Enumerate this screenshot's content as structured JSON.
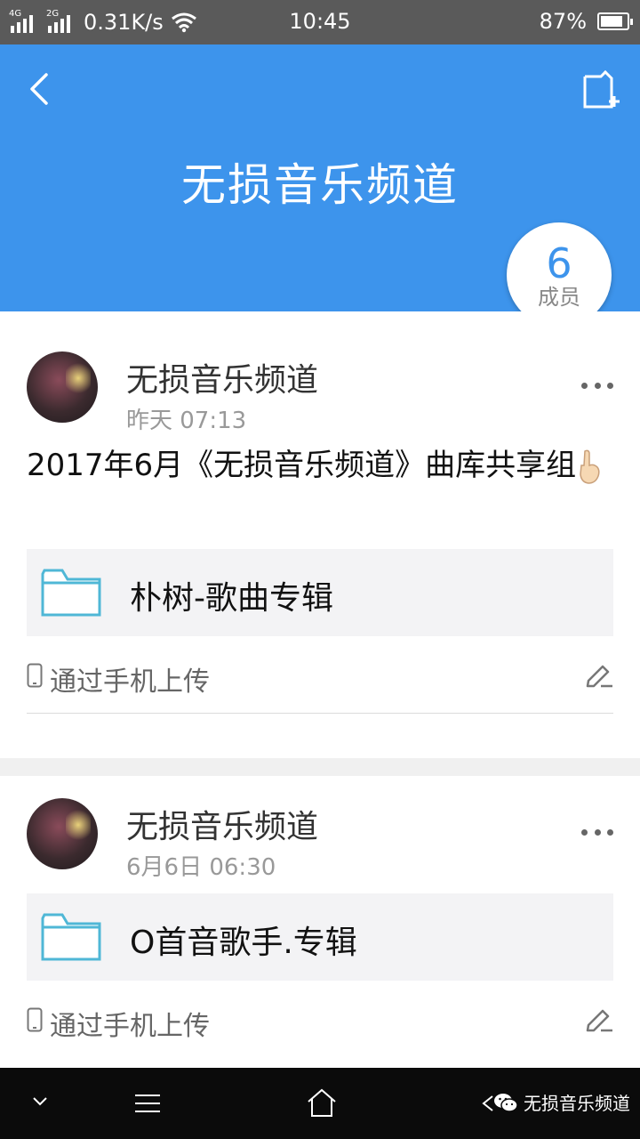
{
  "status_bar": {
    "network_label": "4G",
    "network_label_2": "2G",
    "speed": "0.31K/s",
    "time": "10:45",
    "battery_percent": "87%",
    "battery_level": 0.87
  },
  "header": {
    "title": "无损音乐频道",
    "members_count": "6",
    "members_label": "成员",
    "color": "#3d94ec"
  },
  "posts": [
    {
      "author": "无损音乐频道",
      "time": "昨天 07:13",
      "text": "2017年6月《无损音乐频道》曲库共享组",
      "file_name": "朴树-歌曲专辑",
      "upload_source": "通过手机上传"
    },
    {
      "author": "无损音乐频道",
      "time": "6月6日 06:30",
      "text": "",
      "file_name": "O首音歌手.专辑",
      "upload_source": "通过手机上传"
    }
  ],
  "watermark": "无损音乐频道",
  "icons": [
    "back-arrow-icon",
    "new-note-icon",
    "more-icon",
    "folder-icon",
    "phone-icon",
    "edit-icon",
    "chevron-down-icon",
    "menu-icon",
    "home-icon",
    "wechat-icon"
  ]
}
